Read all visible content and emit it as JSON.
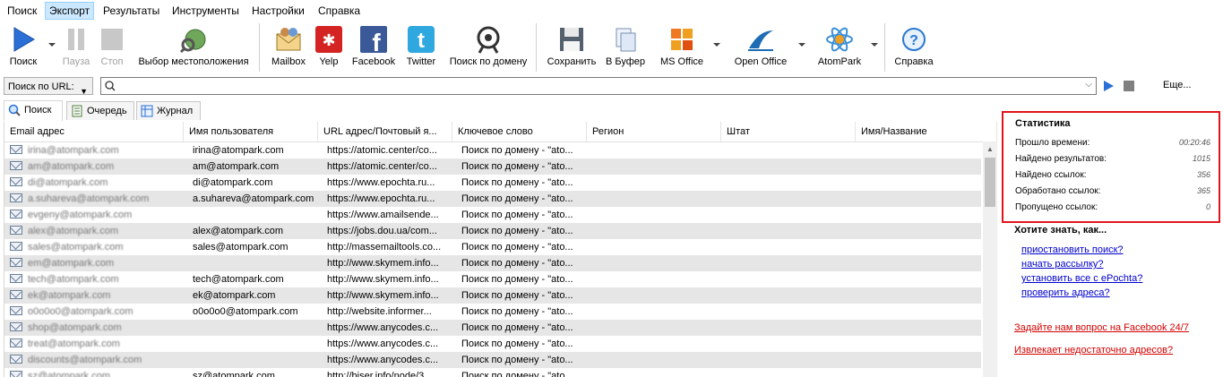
{
  "menu": [
    "Поиск",
    "Экспорт",
    "Результаты",
    "Инструменты",
    "Настройки",
    "Справка"
  ],
  "toolbar": {
    "search": "Поиск",
    "pause": "Пауза",
    "stop": "Стоп",
    "location": "Выбор местоположения",
    "mailbox": "Mailbox",
    "yelp": "Yelp",
    "facebook": "Facebook",
    "twitter": "Twitter",
    "domain_search": "Поиск по домену",
    "save": "Сохранить",
    "clipboard": "В Буфер",
    "ms_office": "MS Office",
    "open_office": "Open Office",
    "atompark": "AtomPark",
    "help": "Справка"
  },
  "urlbar": {
    "mode": "Поиск по URL:",
    "value": "",
    "more": "Еще..."
  },
  "tabs": [
    "Поиск",
    "Очередь",
    "Журнал"
  ],
  "grid": {
    "columns": [
      "Email адрес",
      "Имя пользователя",
      "URL адрес/Почтовый я...",
      "Ключевое слово",
      "Регион",
      "Штат",
      "Имя/Название"
    ],
    "rows": [
      {
        "email": "irina@atompark.com",
        "user": "irina@atompark.com",
        "url": "https://atomic.center/co...",
        "kw": "Поиск по домену - \"ato..."
      },
      {
        "email": "am@atompark.com",
        "user": "am@atompark.com",
        "url": "https://atomic.center/co...",
        "kw": "Поиск по домену - \"ato..."
      },
      {
        "email": "di@atompark.com",
        "user": "di@atompark.com",
        "url": "https://www.epochta.ru...",
        "kw": "Поиск по домену - \"ato..."
      },
      {
        "email": "a.suhareva@atompark.com",
        "user": "a.suhareva@atompark.com",
        "url": "https://www.epochta.ru...",
        "kw": "Поиск по домену - \"ato..."
      },
      {
        "email": "evgeny@atompark.com",
        "user": "",
        "url": "https://www.amailsende...",
        "kw": "Поиск по домену - \"ato..."
      },
      {
        "email": "alex@atompark.com",
        "user": "alex@atompark.com",
        "url": "https://jobs.dou.ua/com...",
        "kw": "Поиск по домену - \"ato..."
      },
      {
        "email": "sales@atompark.com",
        "user": "sales@atompark.com",
        "url": "http://massemailtools.co...",
        "kw": "Поиск по домену - \"ato..."
      },
      {
        "email": "em@atompark.com",
        "user": "",
        "url": "http://www.skymem.info...",
        "kw": "Поиск по домену - \"ato..."
      },
      {
        "email": "tech@atompark.com",
        "user": "tech@atompark.com",
        "url": "http://www.skymem.info...",
        "kw": "Поиск по домену - \"ato..."
      },
      {
        "email": "ek@atompark.com",
        "user": "ek@atompark.com",
        "url": "http://www.skymem.info...",
        "kw": "Поиск по домену - \"ato..."
      },
      {
        "email": "o0o0o0@atompark.com",
        "user": "o0o0o0@atompark.com",
        "url": "http://website.informer...",
        "kw": "Поиск по домену - \"ato..."
      },
      {
        "email": "shop@atompark.com",
        "user": "",
        "url": "https://www.anycodes.c...",
        "kw": "Поиск по домену - \"ato..."
      },
      {
        "email": "treat@atompark.com",
        "user": "",
        "url": "https://www.anycodes.c...",
        "kw": "Поиск по домену - \"ato..."
      },
      {
        "email": "discounts@atompark.com",
        "user": "",
        "url": "https://www.anycodes.c...",
        "kw": "Поиск по домену - \"ato..."
      },
      {
        "email": "sz@atompark.com",
        "user": "sz@atompark.com",
        "url": "http://biser.info/node/3...",
        "kw": "Поиск по домену - \"ato..."
      }
    ]
  },
  "stats": {
    "title": "Статистика",
    "rows": [
      {
        "label": "Прошло времени:",
        "value": "00:20:46"
      },
      {
        "label": "Найдено результатов:",
        "value": "1015"
      },
      {
        "label": "Найдено ссылок:",
        "value": "356"
      },
      {
        "label": "Обработано ссылок:",
        "value": "365"
      },
      {
        "label": "Пропущено ссылок:",
        "value": "0"
      }
    ]
  },
  "howto": {
    "title": "Хотите знать, как...",
    "links": [
      "приостановить поиск?",
      "начать рассылку?",
      "установить все с ePochta?",
      "проверить адреса?"
    ]
  },
  "red_links": [
    "Задайте нам вопрос на Facebook 24/7",
    "Извлекает недостаточно адресов?"
  ],
  "colors": {
    "stats_border": "#e0141c",
    "link": "#0000cc",
    "red_link": "#d40000",
    "alt_row": "#e6e6e6"
  }
}
